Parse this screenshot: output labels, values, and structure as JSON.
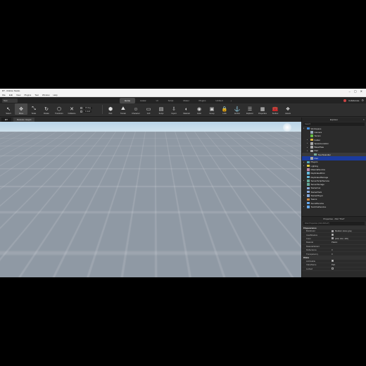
{
  "window": {
    "title": "RT - Roblox Studio",
    "buttons": [
      "–",
      "▢",
      "✕"
    ]
  },
  "menubar": {
    "items": [
      "File",
      "Edit",
      "View",
      "Plugins",
      "Test",
      "Window",
      "Help"
    ]
  },
  "tabsrow": {
    "mode": "Test",
    "tabs": [
      {
        "label": "Home",
        "active": true
      },
      {
        "label": "Avatar",
        "active": false
      },
      {
        "label": "UI",
        "active": false
      },
      {
        "label": "Script",
        "active": false
      },
      {
        "label": "Model",
        "active": false
      },
      {
        "label": "Plugins",
        "active": false
      },
      {
        "label": "Untitled",
        "active": false
      },
      {
        "label": "+",
        "active": false
      }
    ],
    "collaborate": "Collaborate"
  },
  "toolbar": {
    "tools": [
      {
        "label": "Select",
        "icon": "↖",
        "icon_name": "select-icon",
        "selected": false
      },
      {
        "label": "Move",
        "icon": "✥",
        "icon_name": "move-icon",
        "selected": true
      },
      {
        "label": "Scale",
        "icon": "⤡",
        "icon_name": "scale-icon",
        "selected": false
      },
      {
        "label": "Rotate",
        "icon": "↻",
        "icon_name": "rotate-icon",
        "selected": false
      },
      {
        "label": "Transform",
        "icon": "⬡",
        "icon_name": "transform-icon",
        "selected": false
      },
      {
        "label": "Collisions",
        "icon": "✕",
        "icon_name": "collisions-icon",
        "selected": false
      }
    ],
    "snap": {
      "rotate_value": "15 deg",
      "move_value": "1 stud"
    },
    "tools2": [
      {
        "label": "Part",
        "icon": "⬢",
        "icon_name": "part-icon"
      },
      {
        "label": "Terrain",
        "icon": "⛰",
        "icon_name": "terrain-icon"
      },
      {
        "label": "Character",
        "icon": "☺",
        "icon_name": "character-icon"
      },
      {
        "label": "GUI",
        "icon": "▭",
        "icon_name": "gui-icon"
      },
      {
        "label": "Script",
        "icon": "▤",
        "icon_name": "script-icon"
      },
      {
        "label": "Import",
        "icon": "⇩",
        "icon_name": "import-icon"
      },
      {
        "label": "Material",
        "icon": "◐",
        "icon_name": "material-icon"
      },
      {
        "label": "Color",
        "icon": "◉",
        "icon_name": "color-icon"
      },
      {
        "label": "Group",
        "icon": "▣",
        "icon_name": "group-icon"
      },
      {
        "label": "Lock",
        "icon": "🔒",
        "icon_name": "lock-icon"
      },
      {
        "label": "Anchor",
        "icon": "⚓",
        "icon_name": "anchor-icon"
      },
      {
        "label": "Explorer",
        "icon": "☰",
        "icon_name": "explorer-icon"
      },
      {
        "label": "Properties",
        "icon": "▦",
        "icon_name": "properties-icon"
      },
      {
        "label": "Toolbox",
        "icon": "🧰",
        "icon_name": "toolbox-icon"
      },
      {
        "label": "Assets",
        "icon": "❖",
        "icon_name": "assets-icon"
      }
    ]
  },
  "viewport": {
    "tabs": [
      {
        "label": "RT",
        "active": true
      },
      {
        "label": "Release Height",
        "active": false
      }
    ]
  },
  "explorer": {
    "title": "Explorer",
    "search_placeholder": "Search",
    "items": [
      {
        "label": "Workspace",
        "depth": 0,
        "arrow": "▾",
        "color": "#4a90d9",
        "state": ""
      },
      {
        "label": "Camera",
        "depth": 1,
        "arrow": "",
        "color": "#9ab",
        "state": ""
      },
      {
        "label": "Terrain",
        "depth": 1,
        "arrow": "",
        "color": "#6b4",
        "state": ""
      },
      {
        "label": "Folder",
        "depth": 1,
        "arrow": "▸",
        "color": "#d9b13a",
        "state": ""
      },
      {
        "label": "SpawnLocation",
        "depth": 1,
        "arrow": "▸",
        "color": "#aaa",
        "state": ""
      },
      {
        "label": "BasePlate",
        "depth": 1,
        "arrow": "▸",
        "color": "#aaa",
        "state": ""
      },
      {
        "label": "Part",
        "depth": 1,
        "arrow": "▾",
        "color": "#aaa",
        "state": ""
      },
      {
        "label": "TouchHandler",
        "depth": 2,
        "arrow": "",
        "color": "#7a9",
        "state": "hover"
      },
      {
        "label": "Part",
        "depth": 1,
        "arrow": "",
        "color": "#aaa",
        "state": "selected"
      },
      {
        "label": "Players",
        "depth": 0,
        "arrow": "▸",
        "color": "#5ab",
        "state": ""
      },
      {
        "label": "Lighting",
        "depth": 0,
        "arrow": "▸",
        "color": "#dc4",
        "state": ""
      },
      {
        "label": "MaterialService",
        "depth": 0,
        "arrow": "",
        "color": "#b8a",
        "state": ""
      },
      {
        "label": "ReplicatedFirst",
        "depth": 0,
        "arrow": "",
        "color": "#6bd",
        "state": ""
      },
      {
        "label": "ReplicatedStorage",
        "depth": 0,
        "arrow": "",
        "color": "#6bd",
        "state": ""
      },
      {
        "label": "ServerScriptService",
        "depth": 0,
        "arrow": "▸",
        "color": "#6a9",
        "state": ""
      },
      {
        "label": "ServerStorage",
        "depth": 0,
        "arrow": "",
        "color": "#6a9",
        "state": ""
      },
      {
        "label": "StarterGui",
        "depth": 0,
        "arrow": "",
        "color": "#8ad",
        "state": ""
      },
      {
        "label": "StarterPack",
        "depth": 0,
        "arrow": "",
        "color": "#8ad",
        "state": ""
      },
      {
        "label": "StarterPlayer",
        "depth": 0,
        "arrow": "▸",
        "color": "#8ad",
        "state": ""
      },
      {
        "label": "Teams",
        "depth": 0,
        "arrow": "",
        "color": "#c84",
        "state": ""
      },
      {
        "label": "SoundService",
        "depth": 0,
        "arrow": "",
        "color": "#6ae",
        "state": ""
      },
      {
        "label": "TextChatService",
        "depth": 0,
        "arrow": "▸",
        "color": "#6ae",
        "state": ""
      }
    ]
  },
  "properties": {
    "title": "Properties - Part \"Part\"",
    "filter_placeholder": "Filter Properties (Ctrl+Shift+P)",
    "categories": [
      {
        "name": "Appearance",
        "rows": [
          {
            "name": "BrickColor",
            "value": "Medium stone grey",
            "type": "color",
            "swatch": "#a3a2a5"
          },
          {
            "name": "CastShadow",
            "value": "",
            "type": "check",
            "checked": true
          },
          {
            "name": "Color",
            "value": "[163, 162, 165]",
            "type": "color",
            "swatch": "#a3a2a5"
          },
          {
            "name": "Material",
            "value": "Plastic",
            "type": "text"
          },
          {
            "name": "MaterialVariant",
            "value": "",
            "type": "text"
          },
          {
            "name": "Reflectance",
            "value": "0",
            "type": "text"
          },
          {
            "name": "Transparency",
            "value": "0",
            "type": "text"
          }
        ]
      },
      {
        "name": "Data",
        "rows": [
          {
            "name": "Archivable",
            "value": "",
            "type": "check",
            "checked": true
          },
          {
            "name": "ClassName",
            "value": "Part",
            "type": "text"
          },
          {
            "name": "Locked",
            "value": "",
            "type": "check",
            "checked": false
          }
        ]
      }
    ]
  },
  "colors": {
    "selection": "#1b3b9e",
    "gizmo_x": "#d22a2a",
    "gizmo_y": "#2fbf3a",
    "gizmo_z": "#2a40c8"
  }
}
